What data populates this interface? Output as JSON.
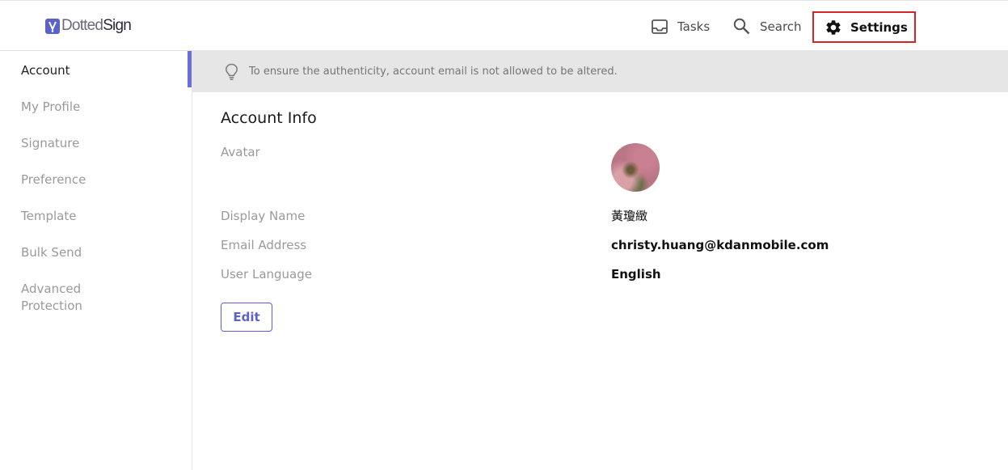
{
  "brand": {
    "logo_part1": "Dotted",
    "logo_part2": "Sign",
    "accent_color": "#5b63c9"
  },
  "topnav": {
    "tasks_label": "Tasks",
    "search_label": "Search",
    "settings_label": "Settings",
    "highlight_color": "#d32525"
  },
  "sidebar": {
    "items": [
      {
        "label": "Account",
        "active": true
      },
      {
        "label": "My Profile"
      },
      {
        "label": "Signature"
      },
      {
        "label": "Preference"
      },
      {
        "label": "Template"
      },
      {
        "label": "Bulk Send"
      },
      {
        "label": "Advanced"
      },
      {
        "label": "Protection"
      }
    ]
  },
  "notice": {
    "text": "To ensure the authenticity, account email is not allowed to be altered."
  },
  "account": {
    "title": "Account Info",
    "avatar_label": "Avatar",
    "display_name_label": "Display Name",
    "display_name": "黃瓊緻",
    "email_label": "Email Address",
    "email": "christy.huang@kdanmobile.com",
    "language_label": "User Language",
    "language": "English",
    "edit_label": "Edit"
  }
}
